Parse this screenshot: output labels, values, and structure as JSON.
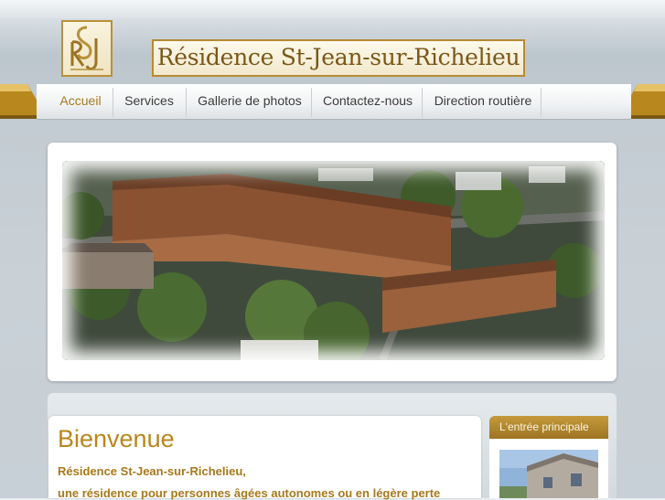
{
  "site": {
    "logo_name": "rsj-monogram-logo",
    "title": "Résidence St-Jean-sur-Richelieu"
  },
  "nav": {
    "items": [
      {
        "label": "Accueil",
        "active": true
      },
      {
        "label": "Services",
        "active": false
      },
      {
        "label": "Gallerie de photos",
        "active": false
      },
      {
        "label": "Contactez-nous",
        "active": false
      },
      {
        "label": "Direction routière",
        "active": false
      }
    ]
  },
  "hero": {
    "image": "aerial-photo-residence-building"
  },
  "main": {
    "heading": "Bienvenue",
    "line1": "Résidence St-Jean-sur-Richelieu,",
    "line2": "une résidence pour personnes âgées autonomes ou en légère perte"
  },
  "sidebar": {
    "heading": "L'entrée principale",
    "image": "main-entrance-photo"
  },
  "colors": {
    "accent_gold": "#b8861d",
    "nav_text": "#3b3b3b",
    "background": "#c7d0d6"
  }
}
